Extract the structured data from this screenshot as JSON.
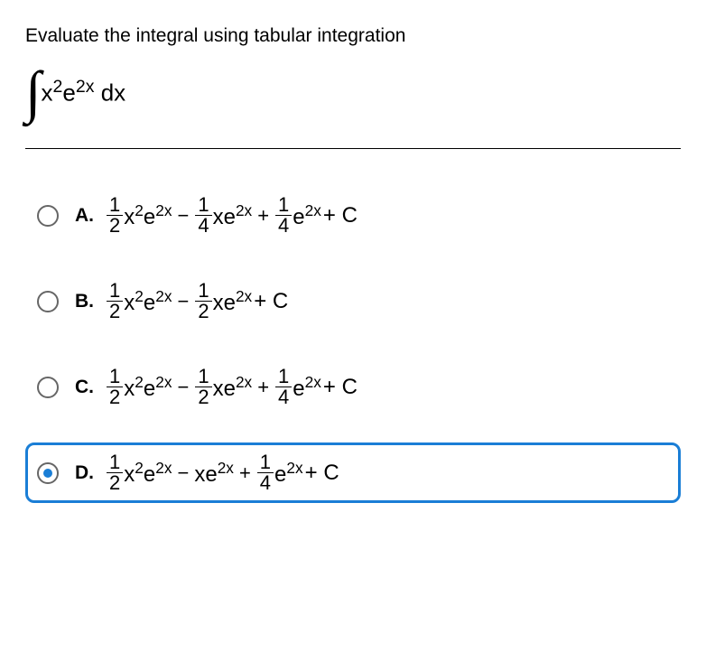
{
  "question": "Evaluate the integral using tabular integration",
  "integral": {
    "integrand_plain": "x²e²ˣ dx",
    "x": "x",
    "sq": "2",
    "e": "e",
    "exp": "2x",
    "dx": " dx"
  },
  "choices": [
    {
      "id": "A",
      "label": "A.",
      "selected": false,
      "terms": [
        {
          "sign": "",
          "num": "1",
          "den": "2",
          "coef": "x",
          "coefSup": "2",
          "base": "e",
          "baseSup": "2x"
        },
        {
          "sign": "−",
          "num": "1",
          "den": "4",
          "coef": "x",
          "coefSup": "",
          "base": "e",
          "baseSup": "2x"
        },
        {
          "sign": "+",
          "num": "1",
          "den": "4",
          "coef": "",
          "coefSup": "",
          "base": "e",
          "baseSup": "2x"
        }
      ],
      "tail": " + C"
    },
    {
      "id": "B",
      "label": "B.",
      "selected": false,
      "terms": [
        {
          "sign": "",
          "num": "1",
          "den": "2",
          "coef": "x",
          "coefSup": "2",
          "base": "e",
          "baseSup": "2x"
        },
        {
          "sign": "−",
          "num": "1",
          "den": "2",
          "coef": "x",
          "coefSup": "",
          "base": "e",
          "baseSup": "2x"
        }
      ],
      "tail": " + C"
    },
    {
      "id": "C",
      "label": "C.",
      "selected": false,
      "terms": [
        {
          "sign": "",
          "num": "1",
          "den": "2",
          "coef": "x",
          "coefSup": "2",
          "base": "e",
          "baseSup": "2x"
        },
        {
          "sign": "−",
          "num": "1",
          "den": "2",
          "coef": "x",
          "coefSup": "",
          "base": "e",
          "baseSup": "2x"
        },
        {
          "sign": "+",
          "num": "1",
          "den": "4",
          "coef": "",
          "coefSup": "",
          "base": "e",
          "baseSup": "2x"
        }
      ],
      "tail": " + C"
    },
    {
      "id": "D",
      "label": "D.",
      "selected": true,
      "terms": [
        {
          "sign": "",
          "num": "1",
          "den": "2",
          "coef": "x",
          "coefSup": "2",
          "base": "e",
          "baseSup": "2x"
        },
        {
          "sign": "−",
          "nofrac": true,
          "coef": "x",
          "coefSup": "",
          "base": "e",
          "baseSup": "2x"
        },
        {
          "sign": "+",
          "num": "1",
          "den": "4",
          "coef": "",
          "coefSup": "",
          "base": "e",
          "baseSup": "2x"
        }
      ],
      "tail": " + C"
    }
  ]
}
